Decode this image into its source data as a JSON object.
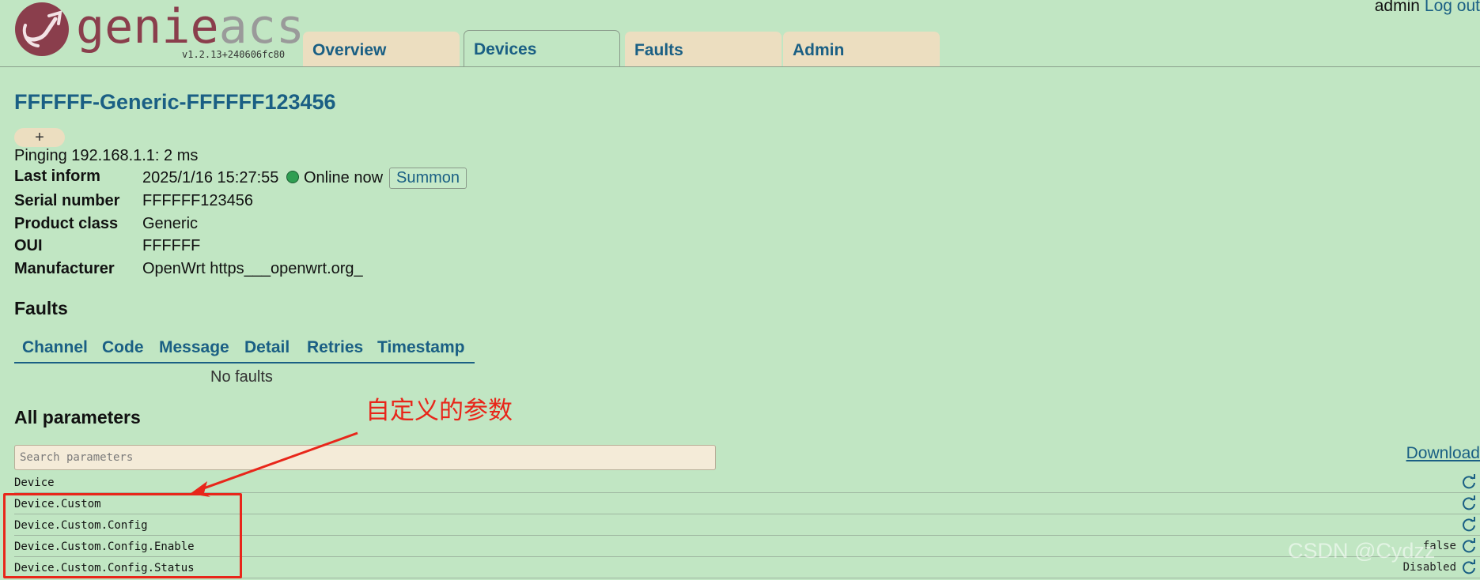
{
  "header": {
    "logo_word_a": "genie",
    "logo_word_b": "acs",
    "version": "v1.2.13+240606fc80",
    "user": "admin",
    "logout": "Log out",
    "tabs": [
      {
        "label": "Overview",
        "active": false
      },
      {
        "label": "Devices",
        "active": true
      },
      {
        "label": "Faults",
        "active": false
      },
      {
        "label": "Admin",
        "active": false
      }
    ]
  },
  "device": {
    "title": "FFFFFF-Generic-FFFFFF123456",
    "tag_add": "+",
    "ping": "Pinging 192.168.1.1: 2 ms",
    "last_inform_label": "Last inform",
    "last_inform_value": "2025/1/16 15:27:55",
    "online_text": "Online now",
    "summon_label": "Summon",
    "serial_label": "Serial number",
    "serial_value": "FFFFFF123456",
    "product_class_label": "Product class",
    "product_class_value": "Generic",
    "oui_label": "OUI",
    "oui_value": "FFFFFF",
    "manufacturer_label": "Manufacturer",
    "manufacturer_value": "OpenWrt https___openwrt.org_"
  },
  "faults": {
    "title": "Faults",
    "columns": [
      "Channel",
      "Code",
      "Message",
      "Detail",
      "Retries",
      "Timestamp"
    ],
    "empty": "No faults"
  },
  "parameters": {
    "title": "All parameters",
    "search_placeholder": "Search parameters",
    "download": "Download",
    "rows": [
      {
        "path": "Device",
        "value": ""
      },
      {
        "path": "Device.Custom",
        "value": ""
      },
      {
        "path": "Device.Custom.Config",
        "value": ""
      },
      {
        "path": "Device.Custom.Config.Enable",
        "value": "false"
      },
      {
        "path": "Device.Custom.Config.Status",
        "value": "Disabled"
      }
    ]
  },
  "annotation": {
    "label": "自定义的参数",
    "color": "#e8261a"
  },
  "watermark": "CSDN @Cydzz",
  "colors": {
    "background": "#c1e6c3",
    "tab": "#ecdec0",
    "link": "#1a5f84",
    "brand": "#8a3e4c"
  }
}
